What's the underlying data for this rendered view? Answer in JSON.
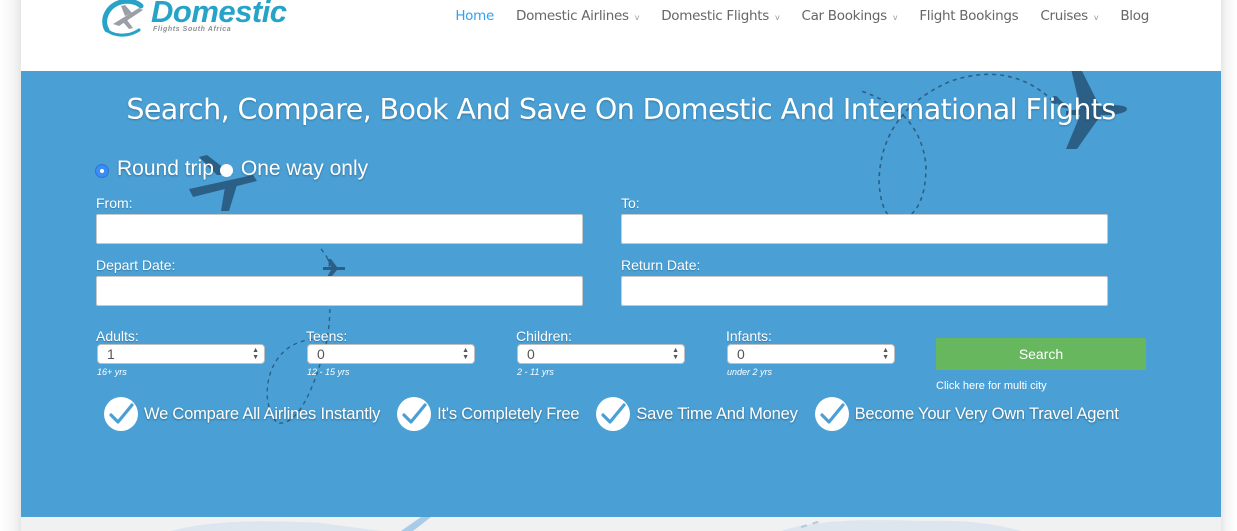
{
  "brand": {
    "name": "Domestic",
    "tagline": "Flights South Africa",
    "color": "#27a3c8"
  },
  "nav": {
    "items": [
      {
        "label": "Home",
        "active": true,
        "dropdown": false
      },
      {
        "label": "Domestic Airlines",
        "active": false,
        "dropdown": true
      },
      {
        "label": "Domestic Flights",
        "active": false,
        "dropdown": true
      },
      {
        "label": "Car Bookings",
        "active": false,
        "dropdown": true
      },
      {
        "label": "Flight Bookings",
        "active": false,
        "dropdown": false
      },
      {
        "label": "Cruises",
        "active": false,
        "dropdown": true
      },
      {
        "label": "Blog",
        "active": false,
        "dropdown": false
      }
    ],
    "caret_glyph": "v",
    "active_color": "#2ea3f2"
  },
  "hero": {
    "title": "Search, Compare, Book And Save On Domestic And International Flights",
    "background_color": "#4aa0d5"
  },
  "search_form": {
    "trip_type": {
      "options": [
        {
          "label": "Round trip",
          "checked": true
        },
        {
          "label": "One way only",
          "checked": false
        }
      ]
    },
    "from": {
      "label": "From:",
      "value": ""
    },
    "to": {
      "label": "To:",
      "value": ""
    },
    "depart_date": {
      "label": "Depart Date:",
      "value": ""
    },
    "return_date": {
      "label": "Return Date:",
      "value": ""
    },
    "passengers": [
      {
        "label": "Adults:",
        "value": "1",
        "hint": "16+ yrs"
      },
      {
        "label": "Teens:",
        "value": "0",
        "hint": "12 - 15 yrs"
      },
      {
        "label": "Children:",
        "value": "0",
        "hint": "2 - 11 yrs"
      },
      {
        "label": "Infants:",
        "value": "0",
        "hint": "under 2 yrs"
      }
    ],
    "search_button": "Search",
    "search_button_color": "#67b75f",
    "multi_city_link": "Click here for multi city"
  },
  "features": [
    "We Compare All Airlines Instantly",
    "It's Completely Free",
    "Save Time And Money",
    "Become Your Very Own Travel Agent"
  ]
}
